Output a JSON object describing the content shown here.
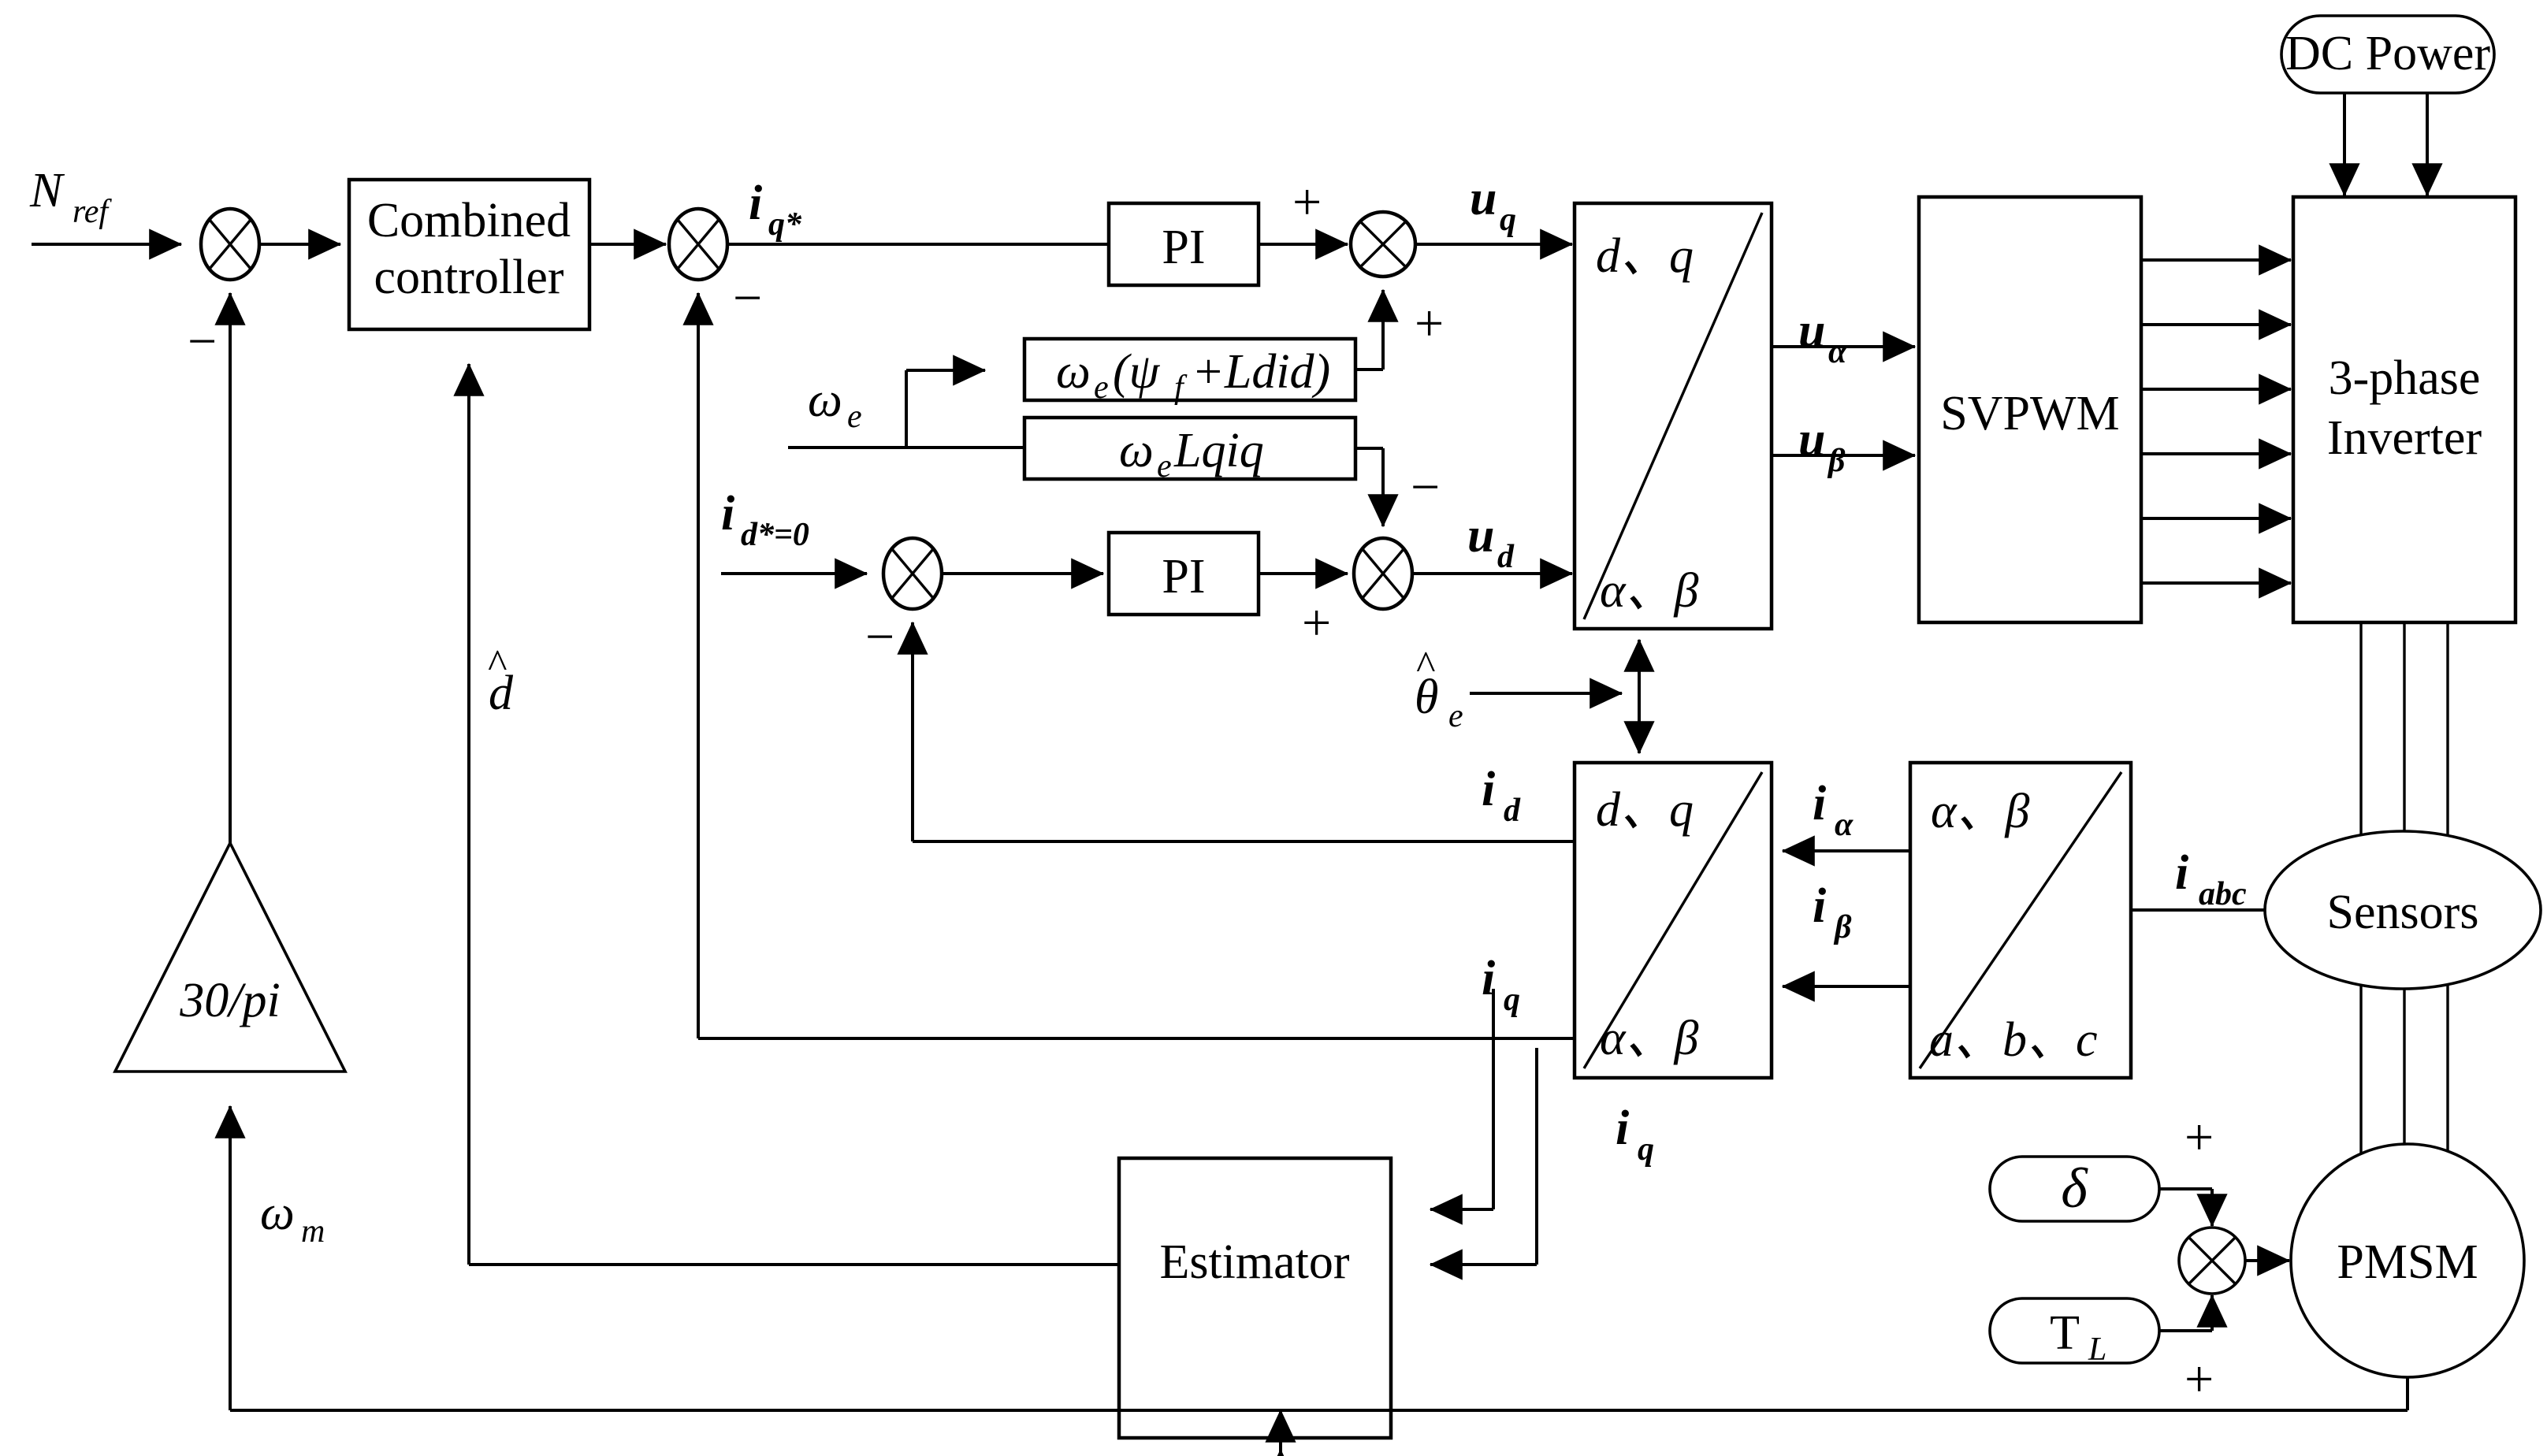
{
  "diagram": {
    "title": "PMSM sensorless field-oriented control block diagram",
    "signals": {
      "n_ref": "N",
      "n_ref_sub": "ref",
      "iq_star": "i",
      "iq_star_sub": "q*",
      "id_star": "i",
      "id_star_sub": "d*=0",
      "uq": "u",
      "uq_sub": "q",
      "ud": "u",
      "ud_sub": "d",
      "ualpha": "u",
      "ualpha_sub": "α",
      "ubeta": "u",
      "ubeta_sub": "β",
      "id": "i",
      "id_sub": "d",
      "iq": "i",
      "iq_sub": "q",
      "iq_bottom": "i",
      "iq_bottom_sub": "q",
      "ialpha": "i",
      "ialpha_sub": "α",
      "ibeta": "i",
      "ibeta_sub": "β",
      "iabc": "i",
      "iabc_sub": "abc",
      "omega_e": "ω",
      "omega_e_sub": "e",
      "omega_m": "ω",
      "omega_m_sub": "m",
      "theta_e_hat": "θ",
      "theta_e_hat_sub": "e",
      "theta_e_hat_mark": "^",
      "d_hat": "d",
      "d_hat_mark": "^"
    },
    "blocks": {
      "combined_controller_line1": "Combined",
      "combined_controller_line2": "controller",
      "pi_q": "PI",
      "pi_d": "PI",
      "decouple_q": "ω",
      "decouple_q_sub": "e",
      "decouple_q_rest": "(ψ",
      "decouple_q_sub2": "f",
      "decouple_q_tail": "+Ldid)",
      "decouple_d": "ω",
      "decouple_d_sub": "e",
      "decouple_d_tail": "Lqiq",
      "dq_to_ab_top": "d、q",
      "dq_to_ab_bottom": "α、β",
      "svpwm": "SVPWM",
      "inverter_line1": "3-phase",
      "inverter_line2": "Inverter",
      "dc_power": "DC Power",
      "pmsm": "PMSM",
      "sensors": "Sensors",
      "ab_to_dq_top": "d、q",
      "ab_to_dq_bottom": "α、β",
      "abc_to_ab_top": "α、β",
      "abc_to_ab_bottom": "a、b、c",
      "estimator": "Estimator",
      "gain_30_pi": "30/pi",
      "delta": "δ",
      "tl": "T",
      "tl_sub": "L"
    },
    "signs": {
      "minus_speed_loop": "−",
      "minus_iq_loop": "−",
      "minus_id_loop": "−",
      "plus_uq_left": "+",
      "plus_uq_bottom": "+",
      "plus_ud_left": "+",
      "minus_ud_top": "−",
      "plus_delta": "+",
      "plus_tl": "+"
    },
    "colors": {
      "line": "#000000",
      "fill": "#ffffff",
      "background": "#ffffff"
    }
  }
}
